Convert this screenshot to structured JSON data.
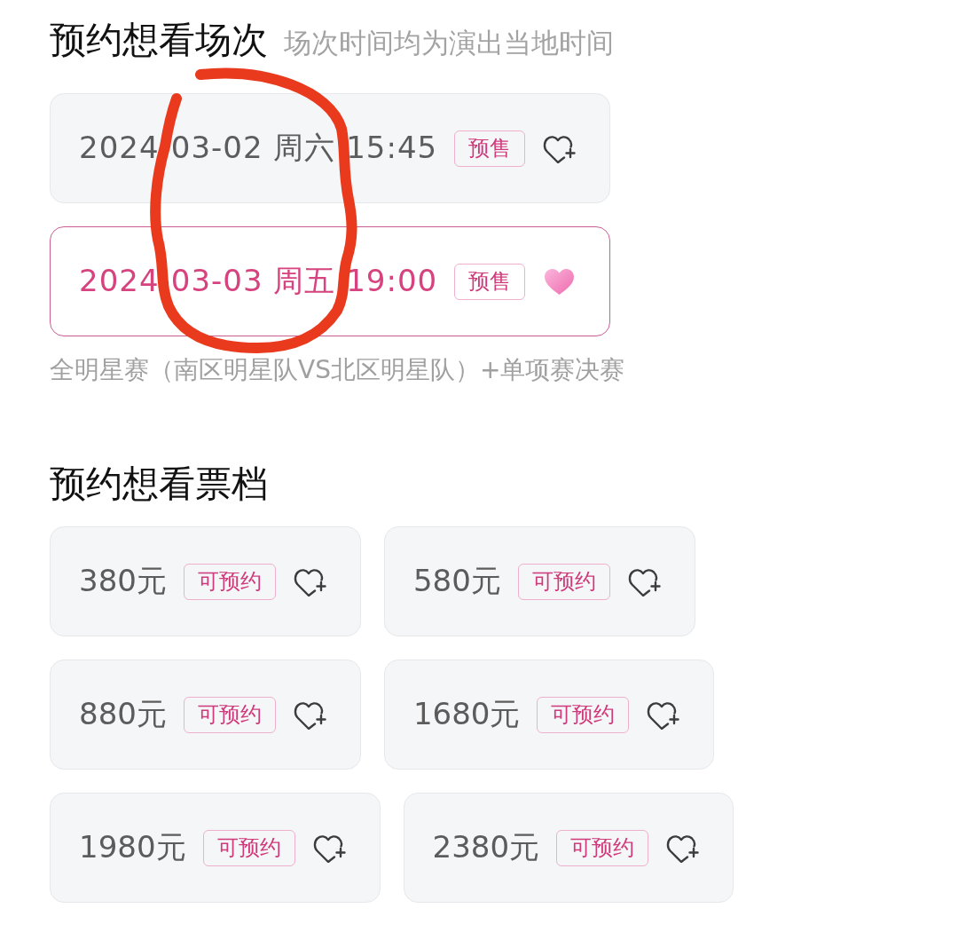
{
  "sessions_section": {
    "title": "预约想看场次",
    "note": "场次时间均为演出当地时间",
    "sessions": [
      {
        "label": "2024-03-02 周六 15:45",
        "tag": "预售",
        "selected": false,
        "favorited": false
      },
      {
        "label": "2024-03-03 周五 19:00",
        "tag": "预售",
        "selected": true,
        "favorited": true
      }
    ],
    "description": "全明星赛（南区明星队VS北区明星队）+单项赛决赛"
  },
  "tiers_section": {
    "title": "预约想看票档",
    "tiers": [
      {
        "price": "380元",
        "tag": "可预约",
        "selected": false,
        "favorited": false
      },
      {
        "price": "580元",
        "tag": "可预约",
        "selected": false,
        "favorited": false
      },
      {
        "price": "880元",
        "tag": "可预约",
        "selected": false,
        "favorited": false
      },
      {
        "price": "1680元",
        "tag": "可预约",
        "selected": false,
        "favorited": false
      },
      {
        "price": "1980元",
        "tag": "可预约",
        "selected": false,
        "favorited": false
      },
      {
        "price": "2380元",
        "tag": "可预约",
        "selected": false,
        "favorited": false
      }
    ]
  }
}
